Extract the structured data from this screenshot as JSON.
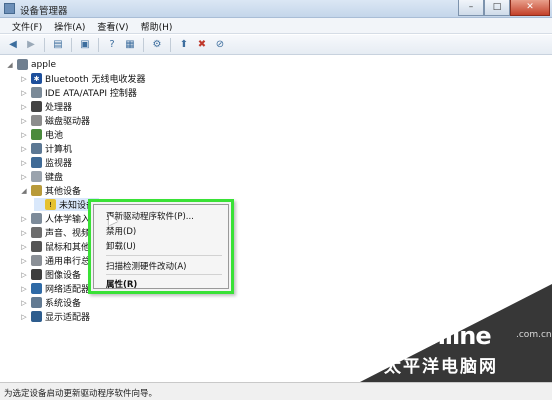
{
  "window": {
    "title": "设备管理器",
    "minimize_glyph": "–",
    "maximize_glyph": "□",
    "close_glyph": "✕"
  },
  "menubar": {
    "items": [
      {
        "label": "文件(F)"
      },
      {
        "label": "操作(A)"
      },
      {
        "label": "查看(V)"
      },
      {
        "label": "帮助(H)"
      }
    ]
  },
  "toolbar": {
    "icons": [
      "back-icon",
      "forward-icon",
      "tree-view-icon",
      "properties-icon",
      "help-icon",
      "device-icon",
      "scan-hardware-icon",
      "update-driver-icon",
      "uninstall-icon",
      "disable-icon"
    ]
  },
  "tree": {
    "root": "apple",
    "categories": [
      {
        "label": "Bluetooth 无线电收发器"
      },
      {
        "label": "IDE ATA/ATAPI 控制器"
      },
      {
        "label": "处理器"
      },
      {
        "label": "磁盘驱动器"
      },
      {
        "label": "电池"
      },
      {
        "label": "计算机"
      },
      {
        "label": "监视器"
      },
      {
        "label": "键盘"
      },
      {
        "label": "其他设备",
        "expanded": true,
        "children": [
          {
            "label": "未知设备"
          }
        ]
      },
      {
        "label": "人体学输入设备"
      },
      {
        "label": "声音、视频和游戏控制器"
      },
      {
        "label": "鼠标和其他指针设备"
      },
      {
        "label": "通用串行总线控制器"
      },
      {
        "label": "图像设备"
      },
      {
        "label": "网络适配器"
      },
      {
        "label": "系统设备"
      },
      {
        "label": "显示适配器"
      }
    ]
  },
  "context_menu": {
    "items": [
      {
        "label": "更新驱动程序软件(P)..."
      },
      {
        "label": "禁用(D)"
      },
      {
        "label": "卸载(U)"
      },
      {
        "label": "扫描检测硬件改动(A)"
      },
      {
        "label": "属性(R)"
      }
    ],
    "highlight_color": "#39e136"
  },
  "statusbar": {
    "text": "为选定设备启动更新驱动程序软件向导。"
  },
  "watermark": {
    "brand": "PConline",
    "domain": ".com.cn",
    "chinese": "太平洋电脑网"
  }
}
